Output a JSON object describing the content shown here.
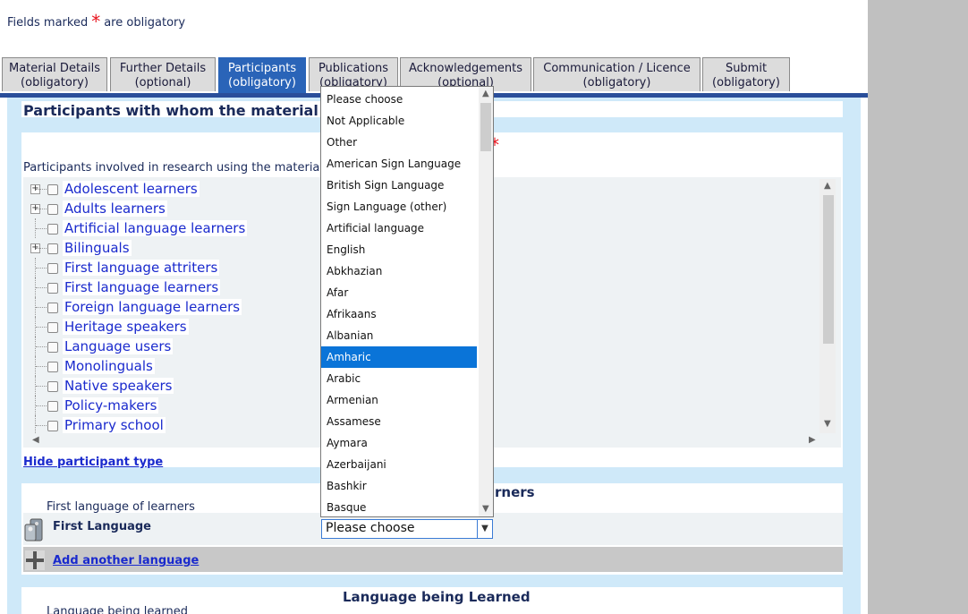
{
  "header": {
    "obligatory_prefix": "Fields marked",
    "obligatory_star": "*",
    "obligatory_suffix": "are obligatory"
  },
  "tabs": [
    {
      "line1": "Material Details",
      "line2": "(obligatory)"
    },
    {
      "line1": "Further Details",
      "line2": "(optional)"
    },
    {
      "line1": "Participants",
      "line2": "(obligatory)"
    },
    {
      "line1": "Publications",
      "line2": "(obligatory)"
    },
    {
      "line1": "Acknowledgements",
      "line2": "(optional)"
    },
    {
      "line1": "Communication / Licence",
      "line2": "(obligatory)"
    },
    {
      "line1": "Submit",
      "line2": "(obligatory)"
    }
  ],
  "section": {
    "title": "Participants with whom the material h",
    "required_star": "*",
    "involved_label": "Participants involved in research using the materia"
  },
  "participants_tree": [
    {
      "label": "Adolescent learners",
      "expandable": true
    },
    {
      "label": "Adults learners",
      "expandable": true
    },
    {
      "label": "Artificial language learners",
      "expandable": false
    },
    {
      "label": "Bilinguals",
      "expandable": true
    },
    {
      "label": "First language attriters",
      "expandable": false
    },
    {
      "label": "First language learners",
      "expandable": false
    },
    {
      "label": "Foreign language learners",
      "expandable": false
    },
    {
      "label": "Heritage speakers",
      "expandable": false
    },
    {
      "label": "Language users",
      "expandable": false
    },
    {
      "label": "Monolinguals",
      "expandable": false
    },
    {
      "label": "Native speakers",
      "expandable": false
    },
    {
      "label": "Policy-makers",
      "expandable": false
    },
    {
      "label": "Primary school",
      "expandable": false
    }
  ],
  "hide_participant_type": "Hide participant type",
  "first_language_section": {
    "heading_fragment": "rners",
    "subtitle": "First language of learners",
    "field_label": "First Language",
    "select_value": "Please choose",
    "add_link": "Add another language"
  },
  "language_learned_section": {
    "heading": "Language being Learned",
    "subtitle": "Language being learned"
  },
  "dropdown": {
    "selected": "Amharic",
    "options": [
      "Please choose",
      "Not Applicable",
      "Other",
      "American Sign Language",
      "British Sign Language",
      "Sign Language (other)",
      "Artificial language",
      "English",
      "Abkhazian",
      "Afar",
      "Afrikaans",
      "Albanian",
      "Amharic",
      "Arabic",
      "Armenian",
      "Assamese",
      "Aymara",
      "Azerbaijani",
      "Bashkir",
      "Basque"
    ]
  },
  "colors": {
    "active_tab": "#2a64b8",
    "link": "#1a2acd",
    "selected_option": "#0a74d8",
    "required": "#e8141e"
  }
}
